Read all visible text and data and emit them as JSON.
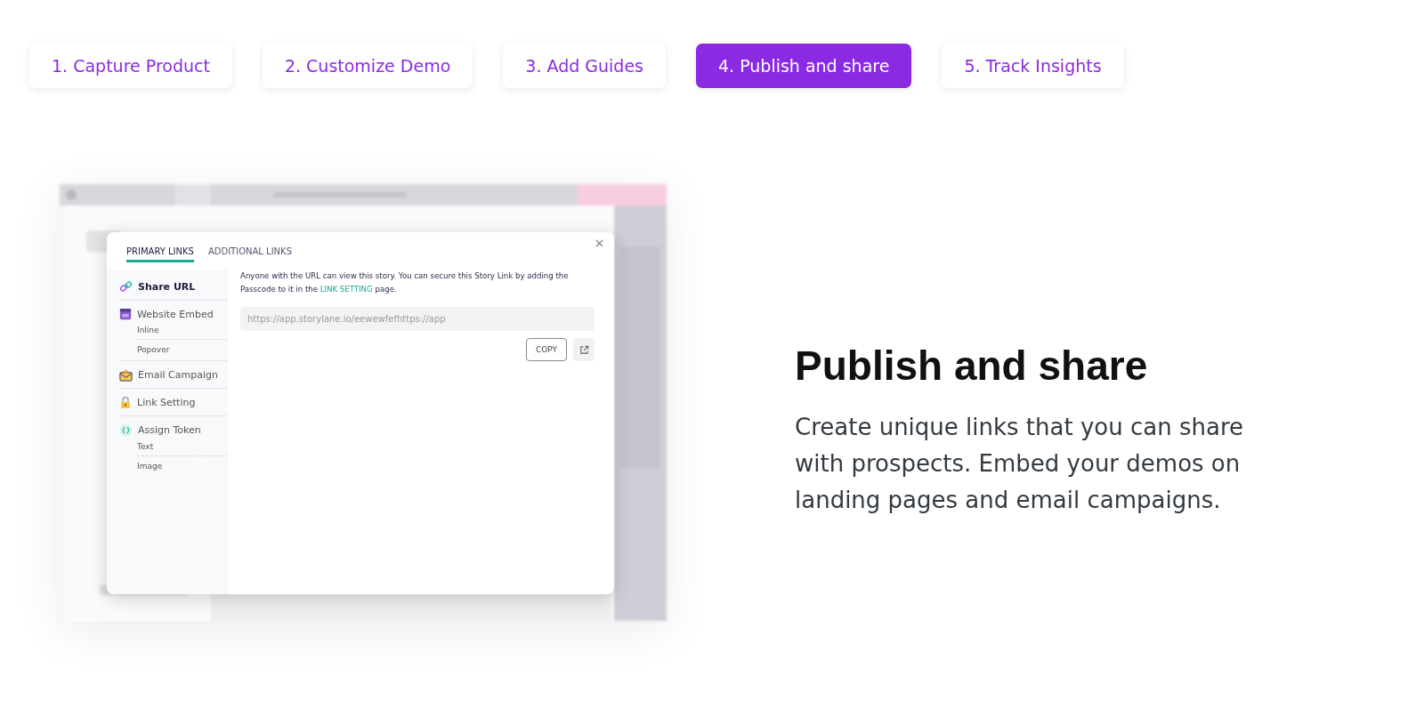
{
  "steps": [
    {
      "label": "1. Capture Product",
      "selected": false
    },
    {
      "label": "2. Customize Demo",
      "selected": false
    },
    {
      "label": "3. Add Guides",
      "selected": false
    },
    {
      "label": "4. Publish and share",
      "selected": true
    },
    {
      "label": "5. Track Insights",
      "selected": false
    }
  ],
  "screenshot": {
    "kind": "picture",
    "dialog": {
      "tabs": [
        {
          "label": "PRIMARY LINKS",
          "selected": true
        },
        {
          "label": "ADDITIONAL LINKS",
          "selected": false
        }
      ],
      "menu": [
        {
          "label": "Share URL",
          "kind": "link",
          "selected": true
        },
        {
          "label": "Website Embed",
          "kind": "embed",
          "selected": false,
          "children": [
            {
              "label": "Inline"
            },
            {
              "label": "Popover"
            }
          ]
        },
        {
          "label": "Email Campaign",
          "kind": "email",
          "selected": false
        },
        {
          "label": "Link Setting",
          "kind": "lock",
          "selected": false
        },
        {
          "label": "Assign Token",
          "kind": "token",
          "selected": false,
          "children": [
            {
              "label": "Text"
            },
            {
              "label": "Image"
            }
          ]
        }
      ],
      "description_start": "Anyone with the URL can view this story. You can secure this Story Link by adding the Passcode to it in the",
      "description_link": "LINK SETTING",
      "description_end": "page.",
      "url_field": {
        "value": "https://app.storylane.io/eewewfefhttps://app"
      },
      "copy_button": "COPY"
    }
  },
  "heading": "Publish and share",
  "body": "Create unique links that you can share with prospects. Embed your demos on landing pages and email campaigns."
}
